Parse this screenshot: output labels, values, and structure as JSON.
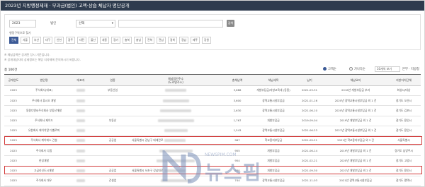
{
  "page_title": "2023년 지방행정제재 · 부과금(법인) 고액·상습 체납자 명단공개",
  "search": {
    "year_value": "2023",
    "name_label": "법인",
    "sort_value": "선택",
    "keyword_value": "",
    "search_button": "검색"
  },
  "region_label": "행정구역으로 찾기",
  "regions": [
    "전체",
    "서울",
    "부산",
    "대구",
    "인천",
    "광주",
    "대전",
    "울산",
    "세종",
    "경기",
    "충북",
    "충남",
    "전북",
    "전남",
    "경북",
    "경남",
    "제주",
    "강원"
  ],
  "notes": [
    "※ 체납금액은 공개된 당시 기준입니다.",
    "※ 공개대상자의 상세정보는 해당 지자체에 문의하시기 바랍니다."
  ],
  "result_count": "총 100건",
  "sort_options": [
    "고액순",
    "가나다순"
  ],
  "page_size": "10개씩 보기",
  "view_label": "본부 · 지방청",
  "table": {
    "headers": [
      "공개연도",
      "법인명",
      "대표자",
      "업종",
      "체납법인주소\n(도로명주소)",
      "총체납액",
      "체납세목",
      "납기",
      "체납요지",
      "지방자치단체"
    ],
    "rows": [
      {
        "year": "2023",
        "name": "주식회사(대표)",
        "rep": "",
        "biz": "부동산업",
        "amount": "3,686",
        "tax": "개발부담금/지방교육세 (동종)",
        "due": "2021-03-31",
        "detail": "2016년 개발부담금 부과",
        "gov": "화성시/대상"
      },
      {
        "year": "2023",
        "name": "주식회사 휴시오 개발",
        "rep": "",
        "biz": "",
        "amount": "3,600",
        "tax": "광역교통시설부담금",
        "due": "2021-01-16",
        "detail": "2020년 광역교통시설부담금 외 1 건",
        "gov": "경기도 오산시"
      },
      {
        "year": "2023",
        "name": "동원디앤씨주식회사 부동산개발",
        "rep": "",
        "biz": "",
        "amount": "2,630",
        "tax": "광역교통시설부담금",
        "due": "2021-06-10",
        "detail": "2020년 광역교통시설부담금 외 1 건",
        "gov": "경기도 김포시"
      },
      {
        "year": "2023",
        "name": "주식회사 제이드",
        "rep": "",
        "biz": "부동산",
        "amount": "1,767",
        "tax": "개발부담금",
        "due": "2019-09-04",
        "detail": "2019년 개발부담금 외 1 건",
        "gov": "경기도 용인시"
      },
      {
        "year": "2023",
        "name": "유한회사 에이치알 디벨로퍼",
        "rep": "",
        "biz": "",
        "amount": "1,543",
        "tax": "광역교통시설부담금",
        "due": "2021-06-23",
        "detail": "2021년 광역교통시설부담금 외 1 건",
        "gov": "경기도 용인시"
      },
      {
        "year": "2023",
        "name": "주식회사 케이에스 건설",
        "rep": "",
        "biz": "공공업",
        "amount": "987",
        "tax": "학교용지부담금",
        "due": "2021-09-21",
        "detail": "2021년 학교용지부담금 외 3 건",
        "gov": "서울특별시"
      },
      {
        "year": "2023",
        "name": "주식회사 디엠",
        "rep": "",
        "biz": "",
        "amount": "955",
        "tax": "개발부담금",
        "due": "2021-06-14",
        "detail": "2019년 개발부담금 외 1 건",
        "gov": "경기도 남양주시"
      },
      {
        "year": "2023",
        "name": "한성개발",
        "rep": "",
        "biz": "",
        "amount": "954",
        "tax": "개발부담금",
        "due": "2021-02-21",
        "detail": "2020년 개발부담금 외 1 건",
        "gov": "경기도 고양시"
      },
      {
        "year": "2023",
        "name": "고금리신도시개발",
        "rep": "",
        "biz": "공공업",
        "amount": "930",
        "tax": "개발부담금",
        "due": "2021-09-30",
        "detail": "2021년 개발부담금 외 2 건",
        "gov": "경기도 용인시"
      },
      {
        "year": "2023",
        "name": "주식회사 대우",
        "rep": "",
        "biz": "건설업",
        "amount": "744",
        "tax": "광역교통시설부담금",
        "due": "2021-11-03",
        "detail": "2021년 광역교통시설부담금",
        "gov": "경기도 평택시"
      }
    ],
    "highlighted_rows": [
      5,
      8
    ],
    "visible_address_fragments": {
      "5": "서울특별시 강남구 테헤란로",
      "8": "서울특별시 서초구 강남대로"
    }
  },
  "watermark": {
    "logo_text": "뉴스핌",
    "sub_text": "NEWSPIM.COM"
  },
  "colors": {
    "accent": "#3c5a96",
    "highlight": "#d23a3a",
    "titlebar": "#2e3b4e"
  }
}
